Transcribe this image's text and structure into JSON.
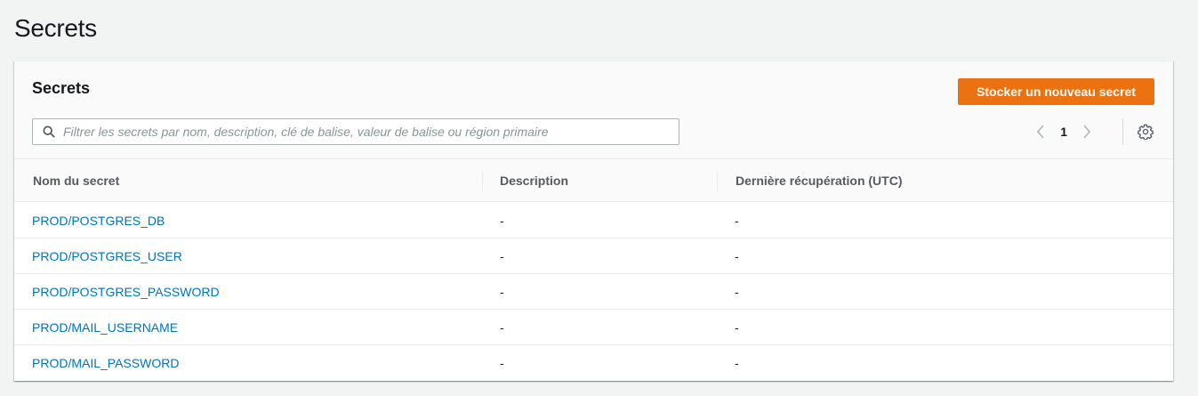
{
  "page": {
    "title": "Secrets"
  },
  "panel": {
    "title": "Secrets",
    "primary_button": "Stocker un nouveau secret",
    "search": {
      "placeholder": "Filtrer les secrets par nom, description, clé de balise, valeur de balise ou région primaire",
      "value": ""
    },
    "pagination": {
      "current_page": "1"
    }
  },
  "table": {
    "columns": [
      "Nom du secret",
      "Description",
      "Dernière récupération (UTC)"
    ],
    "rows": [
      {
        "name": "PROD/POSTGRES_DB",
        "description": "-",
        "last_retrieved": "-"
      },
      {
        "name": "PROD/POSTGRES_USER",
        "description": "-",
        "last_retrieved": "-"
      },
      {
        "name": "PROD/POSTGRES_PASSWORD",
        "description": "-",
        "last_retrieved": "-"
      },
      {
        "name": "PROD/MAIL_USERNAME",
        "description": "-",
        "last_retrieved": "-"
      },
      {
        "name": "PROD/MAIL_PASSWORD",
        "description": "-",
        "last_retrieved": "-"
      }
    ]
  },
  "icons": {
    "search": "search-icon",
    "prev": "chevron-left-icon",
    "next": "chevron-right-icon",
    "settings": "gear-icon"
  },
  "colors": {
    "primary": "#ec7211",
    "link": "#0073bb",
    "background": "#f2f3f3"
  }
}
